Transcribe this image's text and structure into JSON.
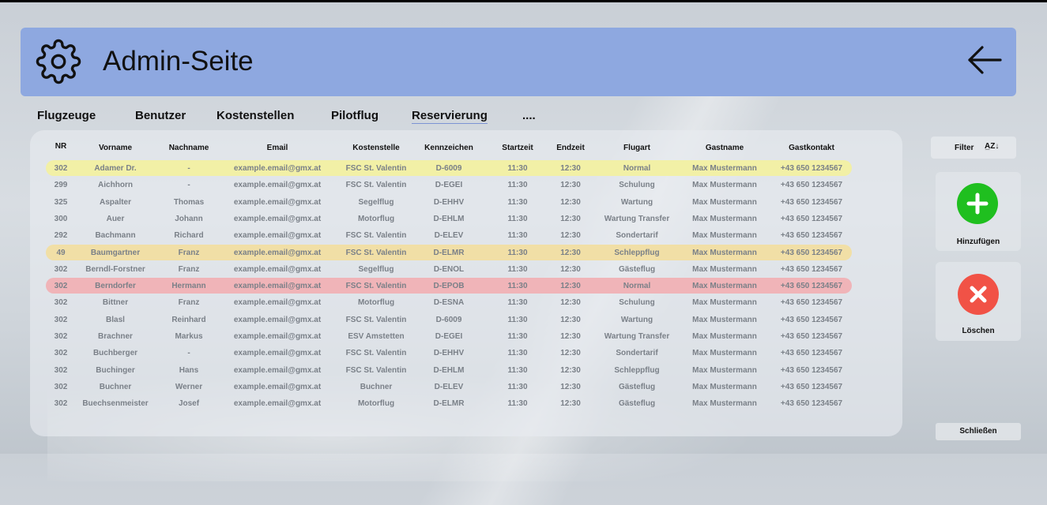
{
  "header": {
    "title": "Admin-Seite"
  },
  "tabs": [
    {
      "label": "Flugzeuge"
    },
    {
      "label": "Benutzer"
    },
    {
      "label": "Kostenstellen"
    },
    {
      "label": "Pilotflug"
    },
    {
      "label": "Reservierung"
    },
    {
      "label": "...."
    }
  ],
  "table": {
    "columns": [
      "NR",
      "Vorname",
      "Nachname",
      "Email",
      "Kostenstelle",
      "Kennzeichen",
      "Startzeit",
      "Endzeit",
      "Flugart",
      "Gastname",
      "Gastkontakt"
    ],
    "rows": [
      [
        "302",
        "Adamer Dr.",
        "-",
        "example.email@gmx.at",
        "FSC St. Valentin",
        "D-6009",
        "11:30",
        "12:30",
        "Normal",
        "Max Mustermann",
        "+43 650 1234567"
      ],
      [
        "299",
        "Aichhorn",
        "-",
        "example.email@gmx.at",
        "FSC St. Valentin",
        "D-EGEI",
        "11:30",
        "12:30",
        "Schulung",
        "Max Mustermann",
        "+43 650 1234567"
      ],
      [
        "325",
        "Aspalter",
        "Thomas",
        "example.email@gmx.at",
        "Segelflug",
        "D-EHHV",
        "11:30",
        "12:30",
        "Wartung",
        "Max Mustermann",
        "+43 650 1234567"
      ],
      [
        "300",
        "Auer",
        "Johann",
        "example.email@gmx.at",
        "Motorflug",
        "D-EHLM",
        "11:30",
        "12:30",
        "Wartung Transfer",
        "Max Mustermann",
        "+43 650 1234567"
      ],
      [
        "292",
        "Bachmann",
        "Richard",
        "example.email@gmx.at",
        "FSC St. Valentin",
        "D-ELEV",
        "11:30",
        "12:30",
        "Sondertarif",
        "Max Mustermann",
        "+43 650 1234567"
      ],
      [
        "49",
        "Baumgartner",
        "Franz",
        "example.email@gmx.at",
        "FSC St. Valentin",
        "D-ELMR",
        "11:30",
        "12:30",
        "Schleppflug",
        "Max Mustermann",
        "+43 650 1234567"
      ],
      [
        "302",
        "Berndl-Forstner",
        "Franz",
        "example.email@gmx.at",
        "Segelflug",
        "D-ENOL",
        "11:30",
        "12:30",
        "Gästeflug",
        "Max Mustermann",
        "+43 650 1234567"
      ],
      [
        "302",
        "Berndorfer",
        "Hermann",
        "example.email@gmx.at",
        "FSC St. Valentin",
        "D-EPOB",
        "11:30",
        "12:30",
        "Normal",
        "Max Mustermann",
        "+43 650 1234567"
      ],
      [
        "302",
        "Bittner",
        "Franz",
        "example.email@gmx.at",
        "Motorflug",
        "D-ESNA",
        "11:30",
        "12:30",
        "Schulung",
        "Max Mustermann",
        "+43 650 1234567"
      ],
      [
        "302",
        "Blasl",
        "Reinhard",
        "example.email@gmx.at",
        "FSC St. Valentin",
        "D-6009",
        "11:30",
        "12:30",
        "Wartung",
        "Max Mustermann",
        "+43 650 1234567"
      ],
      [
        "302",
        "Brachner",
        "Markus",
        "example.email@gmx.at",
        "ESV Amstetten",
        "D-EGEI",
        "11:30",
        "12:30",
        "Wartung Transfer",
        "Max Mustermann",
        "+43 650 1234567"
      ],
      [
        "302",
        "Buchberger",
        "-",
        "example.email@gmx.at",
        "FSC St. Valentin",
        "D-EHHV",
        "11:30",
        "12:30",
        "Sondertarif",
        "Max Mustermann",
        "+43 650 1234567"
      ],
      [
        "302",
        "Buchinger",
        "Hans",
        "example.email@gmx.at",
        "FSC St. Valentin",
        "D-EHLM",
        "11:30",
        "12:30",
        "Schleppflug",
        "Max Mustermann",
        "+43 650 1234567"
      ],
      [
        "302",
        "Buchner",
        "Werner",
        "example.email@gmx.at",
        "Buchner",
        "D-ELEV",
        "11:30",
        "12:30",
        "Gästeflug",
        "Max Mustermann",
        "+43 650 1234567"
      ],
      [
        "302",
        "Buechsenmeister",
        "Josef",
        "example.email@gmx.at",
        "Motorflug",
        "D-ELMR",
        "11:30",
        "12:30",
        "Gästeflug",
        "Max Mustermann",
        "+43 650 1234567"
      ]
    ],
    "highlights": [
      {
        "row": 0,
        "color": "#f2f0a6"
      },
      {
        "row": 5,
        "color": "#f1dfa6"
      },
      {
        "row": 7,
        "color": "#f0b4b8"
      }
    ]
  },
  "filter": {
    "label": "Filter",
    "sort_icon": "sort-az-icon"
  },
  "actions": {
    "add_label": "Hinzufügen",
    "add_color": "#1fbf1f",
    "delete_label": "Löschen",
    "delete_color": "#f15246",
    "close_label": "Schließen"
  },
  "colors": {
    "header_bg": "#8ea8e0",
    "tab_underline": "#7c93d4"
  }
}
